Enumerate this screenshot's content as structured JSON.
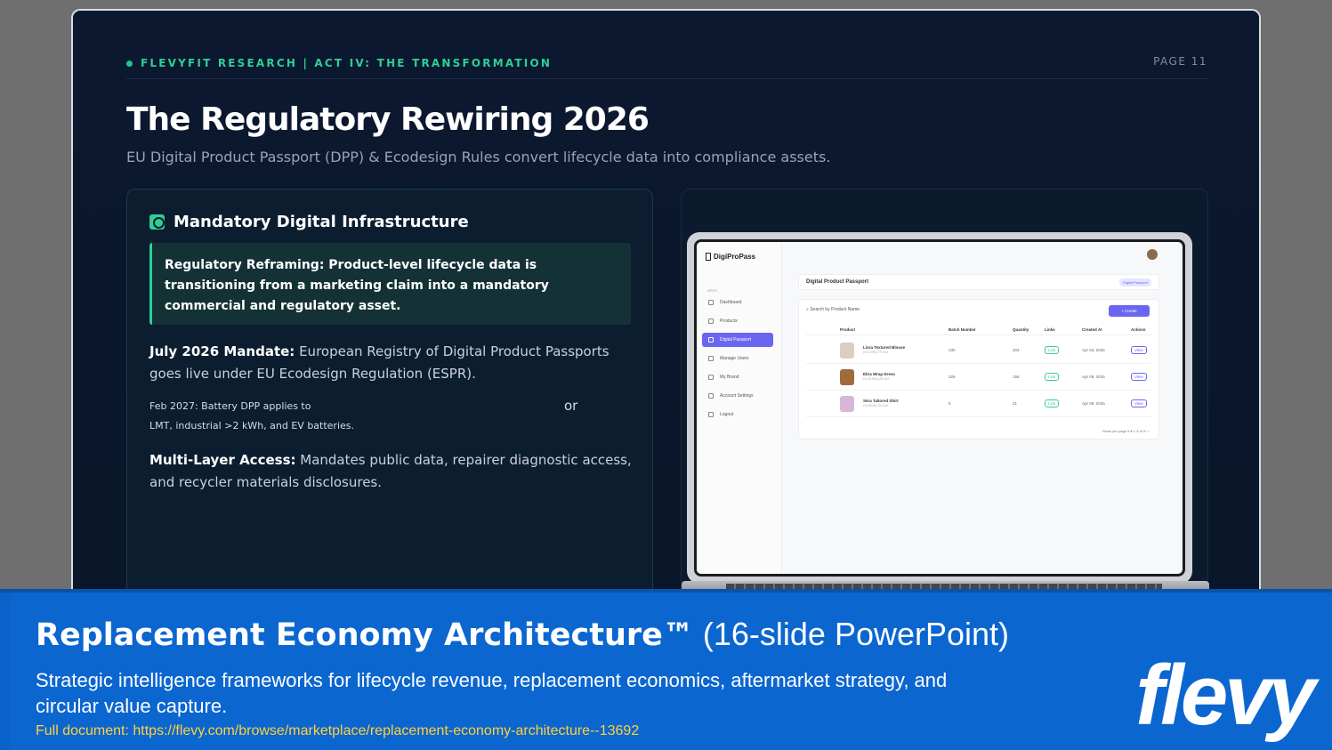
{
  "slide": {
    "kicker": "FLEVYFIT RESEARCH | ACT IV: THE TRANSFORMATION",
    "page": "PAGE 11",
    "title": "The Regulatory Rewiring 2026",
    "subtitle": "EU Digital Product Passport (DPP) & Ecodesign Rules convert lifecycle data into compliance assets.",
    "left_card": {
      "title": "Mandatory Digital Infrastructure",
      "callout": "Regulatory Reframing: Product-level lifecycle data is transitioning from a marketing claim into a mandatory commercial and regulatory asset.",
      "p1_lead": "July 2026 Mandate:",
      "p1_text": " European Registry of Digital Product Passports goes live under EU Ecodesign Regulation (ESPR).",
      "small_line1": "Feb 2027: Battery DPP applies to",
      "small_line2": "LMT, industrial >2 kWh, and EV batteries.",
      "or": "or",
      "p3_lead": "Multi-Layer Access:",
      "p3_text": " Mandates public data, repairer diagnostic access, and recycler materials disclosures."
    },
    "app": {
      "brand": "DigiProPass",
      "nav_group": "APPS",
      "nav": [
        "Dashboard",
        "Products",
        "Digital Passport",
        "Manage Users",
        "My Brand",
        "Account Settings",
        "Logout"
      ],
      "page_title": "Digital Product Passport",
      "page_badge": "Digital Passport",
      "search_placeholder": "Search by Product Name",
      "create_label": "+ Create",
      "columns": [
        "Product",
        "Batch Number",
        "Quantity",
        "Links",
        "Created At",
        "Actions"
      ],
      "rows": [
        {
          "name": "Liora Textured Blouse",
          "sku": "HV-LORA-TP-003",
          "batch": "230",
          "qty": "203",
          "link": "Link",
          "created": "Apr 03, 2026",
          "action": "View"
        },
        {
          "name": "Elira Wrap Dress",
          "sku": "HV-ELIRA-DR-002",
          "batch": "326",
          "qty": "156",
          "link": "Link",
          "created": "Apr 09, 2026",
          "action": "View"
        },
        {
          "name": "Séra Tailored Shirt",
          "sku": "HV-SERA-SH-001",
          "batch": "5",
          "qty": "21",
          "link": "Link",
          "created": "Apr 09, 2026",
          "action": "View"
        }
      ],
      "pager": "Rows per page  5  ▾     1-3 of 3     ‹   ›"
    }
  },
  "banner": {
    "title_bold": "Replacement Economy Architecture™",
    "title_light": " (16-slide PowerPoint)",
    "description": "Strategic intelligence frameworks for lifecycle revenue, replacement economics, aftermarket strategy, and circular value capture.",
    "link": "Full document: https://flevy.com/browse/marketplace/replacement-economy-architecture--13692",
    "logo": "flevy"
  },
  "colors": {
    "accent_green": "#2ecf94",
    "banner_blue": "#0b66d0",
    "link_yellow": "#ffd23a",
    "app_purple": "#6b66f0"
  }
}
